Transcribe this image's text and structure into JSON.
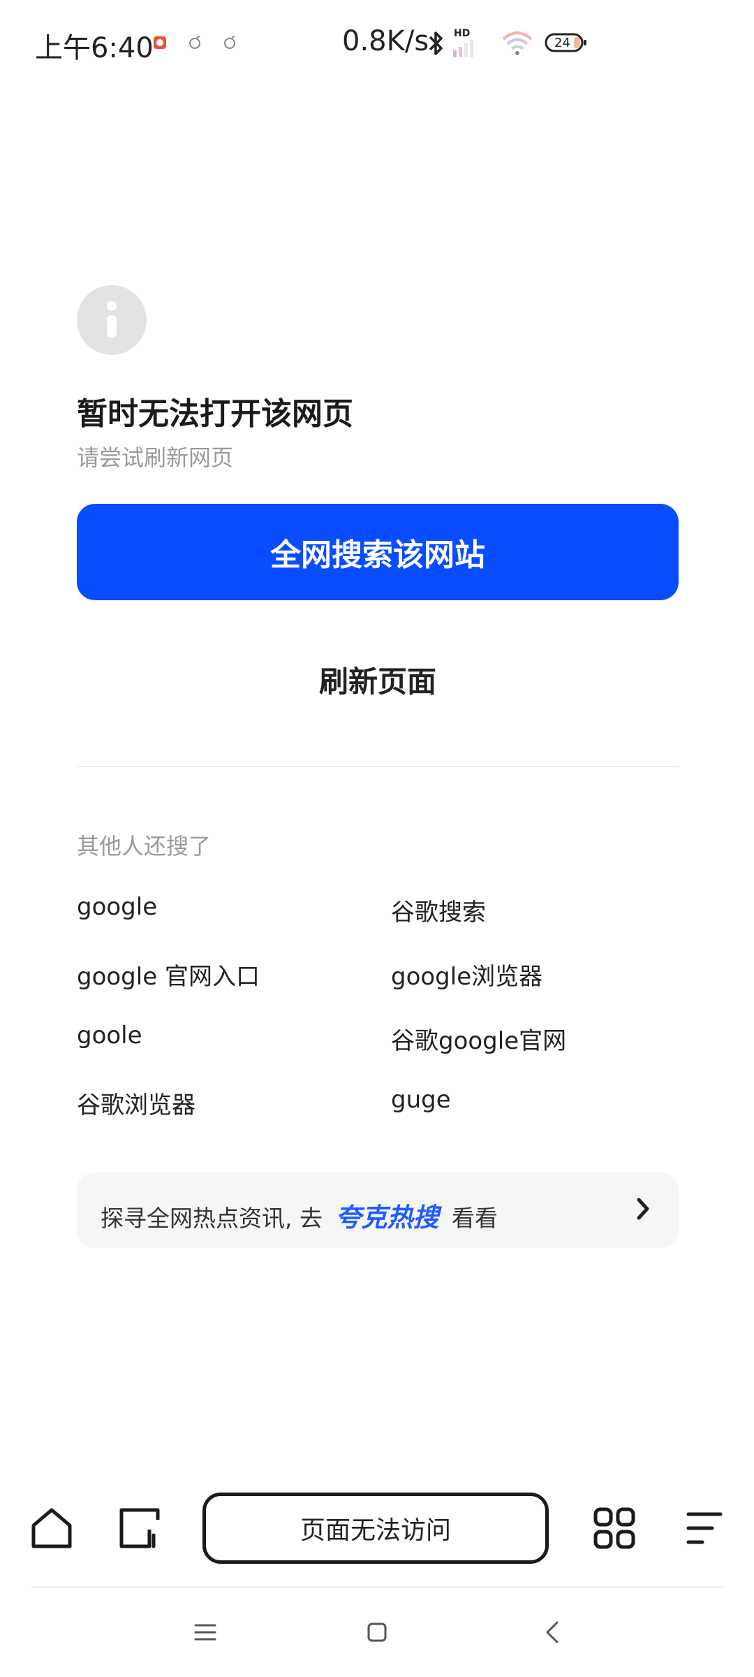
{
  "status_bar": {
    "time": "上午6:40",
    "speed": "0.8K/s",
    "network": "HD",
    "battery": "24"
  },
  "error": {
    "title": "暂时无法打开该网页",
    "subtitle": "请尝试刷新网页",
    "primary_button": "全网搜索该网站",
    "refresh_button": "刷新页面"
  },
  "related": {
    "heading": "其他人还搜了",
    "items": [
      "google",
      "谷歌搜索",
      "google 官网入口",
      "google浏览器",
      "goole",
      "谷歌google官网",
      "谷歌浏览器",
      "guge"
    ]
  },
  "hot_banner": {
    "prefix": "探寻全网热点资讯, 去",
    "brand": "夸克热搜",
    "suffix": "看看"
  },
  "bottom_bar": {
    "address_text": "页面无法访问"
  },
  "colors": {
    "accent": "#0a4dff",
    "brand_text": "#1f5bff"
  }
}
